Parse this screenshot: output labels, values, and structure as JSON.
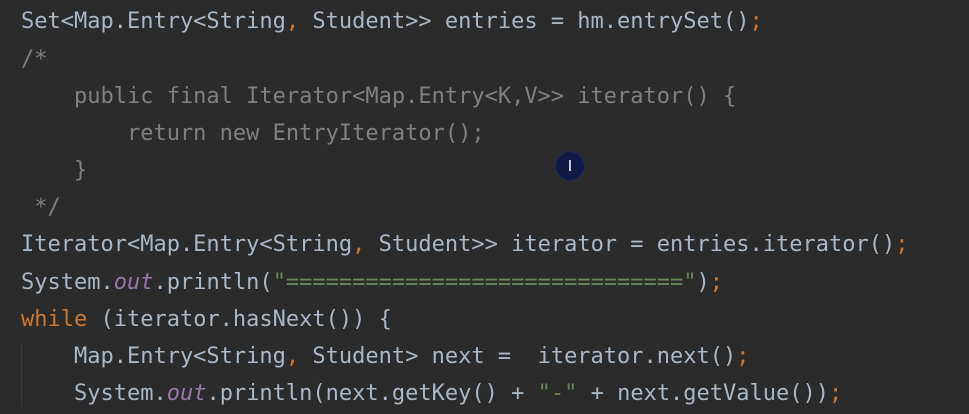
{
  "editor": {
    "lines": [
      {
        "tokens": [
          {
            "text": "Set<Map.Entry<String",
            "type": "default"
          },
          {
            "text": ", ",
            "type": "keyword"
          },
          {
            "text": "Student>> entries = hm.entrySet()",
            "type": "default"
          },
          {
            "text": ";",
            "type": "keyword"
          }
        ]
      },
      {
        "tokens": [
          {
            "text": "/*",
            "type": "comment"
          }
        ]
      },
      {
        "tokens": [
          {
            "text": "    public final Iterator<Map.Entry<K,V>> iterator() {",
            "type": "comment"
          }
        ]
      },
      {
        "tokens": [
          {
            "text": "        return new EntryIterator();",
            "type": "comment"
          }
        ]
      },
      {
        "tokens": [
          {
            "text": "    }",
            "type": "comment"
          }
        ]
      },
      {
        "tokens": [
          {
            "text": " */",
            "type": "comment"
          }
        ]
      },
      {
        "tokens": [
          {
            "text": "Iterator<Map.Entry<String",
            "type": "default"
          },
          {
            "text": ", ",
            "type": "keyword"
          },
          {
            "text": "Student>> iterator = entries.iterator()",
            "type": "default"
          },
          {
            "text": ";",
            "type": "keyword"
          }
        ]
      },
      {
        "tokens": [
          {
            "text": "System.",
            "type": "default"
          },
          {
            "text": "out",
            "type": "static"
          },
          {
            "text": ".println(",
            "type": "default"
          },
          {
            "text": "\"==============================\"",
            "type": "string"
          },
          {
            "text": ")",
            "type": "default"
          },
          {
            "text": ";",
            "type": "keyword"
          }
        ]
      },
      {
        "tokens": [
          {
            "text": "while",
            "type": "keyword"
          },
          {
            "text": " (iterator.hasNext()) {",
            "type": "default"
          }
        ]
      },
      {
        "tokens": [
          {
            "text": "    Map.Entry<String",
            "type": "default"
          },
          {
            "text": ", ",
            "type": "keyword"
          },
          {
            "text": "Student> next =  iterator.next()",
            "type": "default"
          },
          {
            "text": ";",
            "type": "keyword"
          }
        ]
      },
      {
        "tokens": [
          {
            "text": "    System.",
            "type": "default"
          },
          {
            "text": "out",
            "type": "static"
          },
          {
            "text": ".println(next.getKey() + ",
            "type": "default"
          },
          {
            "text": "\"-\"",
            "type": "string"
          },
          {
            "text": " + next.getValue())",
            "type": "default"
          },
          {
            "text": ";",
            "type": "keyword"
          }
        ]
      }
    ]
  },
  "cursor": {
    "icon": "i-beam-cursor-icon",
    "glyph": "I"
  },
  "colors": {
    "background": "#2b2b2b",
    "default": "#a9b7c6",
    "keyword": "#cc7832",
    "comment": "#808080",
    "string": "#6a8759",
    "static_field": "#9876aa"
  }
}
